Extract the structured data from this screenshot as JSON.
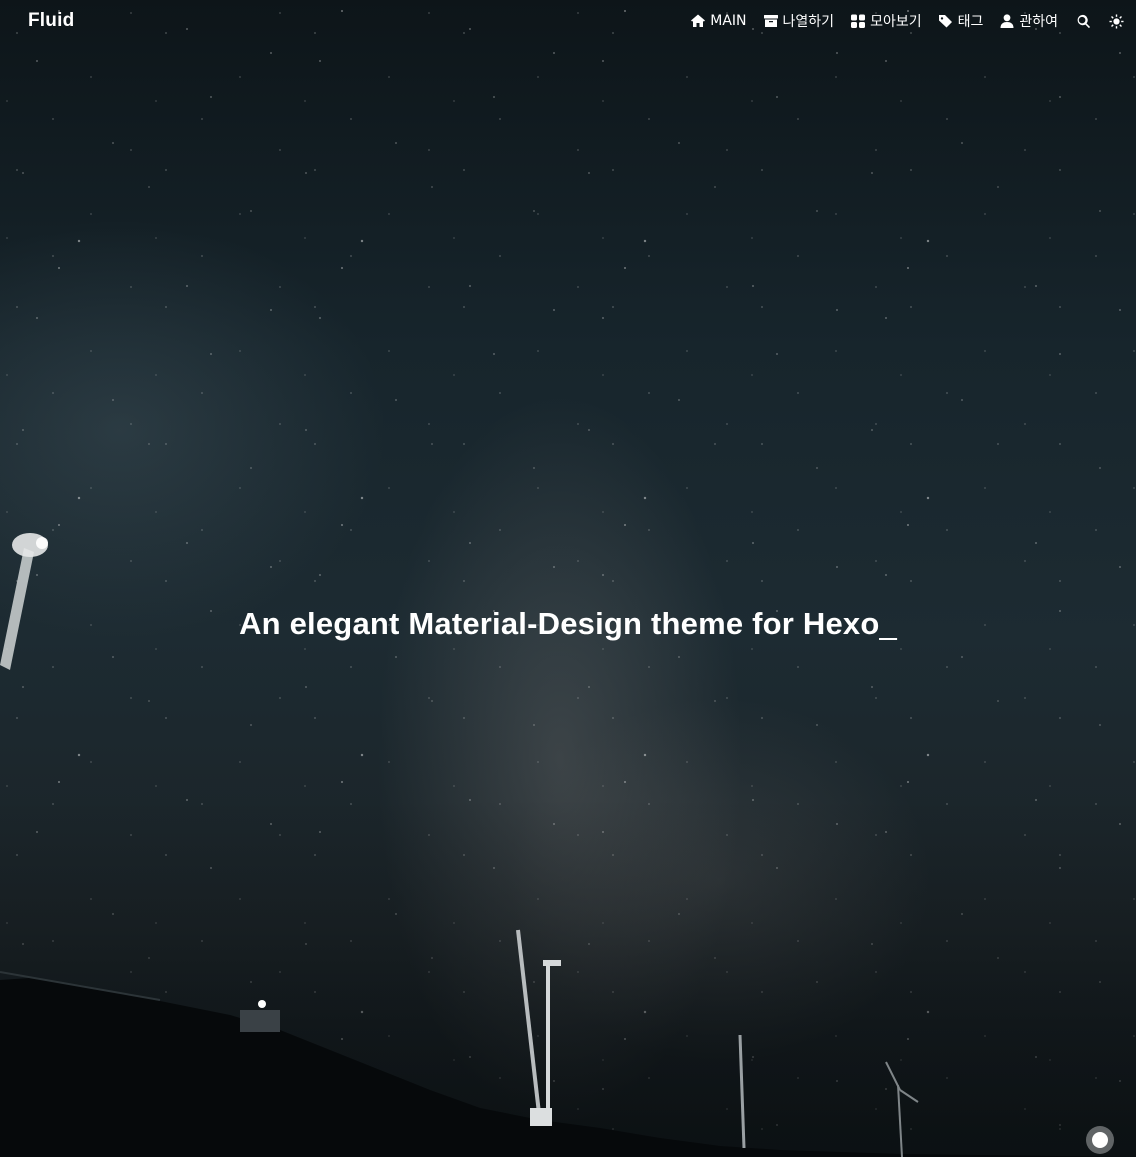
{
  "navbar": {
    "brand": "Fluid",
    "items": [
      {
        "label": "MAIN",
        "icon": "home-icon"
      },
      {
        "label": "나열하기",
        "icon": "archive-icon"
      },
      {
        "label": "모아보기",
        "icon": "categories-icon"
      },
      {
        "label": "태그",
        "icon": "tags-icon"
      },
      {
        "label": "관하여",
        "icon": "user-icon"
      }
    ],
    "search_icon": "search-icon",
    "theme_toggle_icon": "sun-icon"
  },
  "hero": {
    "subtitle": "An elegant Material-Design theme for Hexo",
    "cursor": "_"
  }
}
